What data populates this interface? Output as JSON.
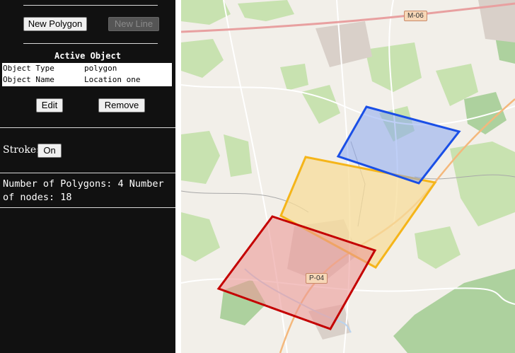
{
  "toolbar": {
    "new_polygon": "New Polygon",
    "new_line": "New Line"
  },
  "active_object": {
    "title": "Active Object",
    "rows": [
      {
        "key": "Object Type",
        "value": "polygon"
      },
      {
        "key": "Object Name",
        "value": "Location one"
      }
    ],
    "edit": "Edit",
    "remove": "Remove"
  },
  "stroke": {
    "label": "Stroke:",
    "button": "On"
  },
  "stats": {
    "line1": "Number of Polygons: 4 Number",
    "line2": "of nodes: 18"
  },
  "map": {
    "road_labels": [
      "M-06",
      "P-04"
    ],
    "polygons": [
      {
        "name": "blue",
        "stroke": "#1a4fe6",
        "fill": "#8aa8f0"
      },
      {
        "name": "yellow",
        "stroke": "#f5b51a",
        "fill": "#f7dc9a"
      },
      {
        "name": "red",
        "stroke": "#c40000",
        "fill": "#eb9a98"
      }
    ]
  }
}
